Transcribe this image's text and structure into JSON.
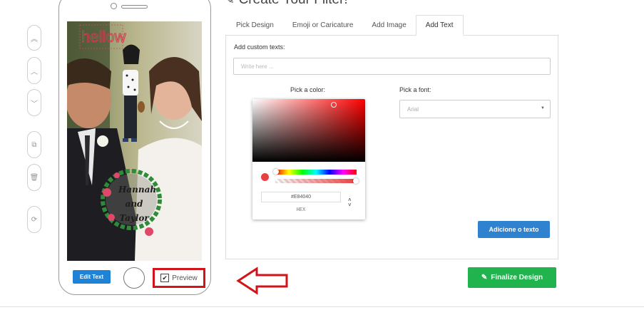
{
  "left_toolbar": {
    "buttons": [
      {
        "name": "bring-to-front",
        "glyph": "«"
      },
      {
        "name": "move-up",
        "glyph": "˄"
      },
      {
        "name": "move-down",
        "glyph": "˅"
      },
      {
        "name": "duplicate",
        "glyph": "⧉"
      },
      {
        "name": "delete",
        "glyph": "🗑"
      },
      {
        "name": "refresh",
        "glyph": "⟳"
      }
    ]
  },
  "phone": {
    "overlay_text": "hellow",
    "wreath_names": "Hannah and Taylor",
    "edit_text_label": "Edit Text",
    "preview_label": "Preview",
    "preview_checked": "✔"
  },
  "panel": {
    "title": "Create Your Filter!",
    "tabs": [
      {
        "label": "Pick Design"
      },
      {
        "label": "Emoji or Caricature"
      },
      {
        "label": "Add Image"
      },
      {
        "label": "Add Text",
        "active": true
      }
    ],
    "custom_text_label": "Add custom texts:",
    "custom_text_placeholder": "Write here ...",
    "pick_color_label": "Pick a color:",
    "pick_font_label": "Pick a font:",
    "font_value": "Arial",
    "color_hex": "#E84040",
    "color_format_label": "HEX",
    "add_text_button": "Adicione o texto",
    "finalize_button": "Finalize Design"
  },
  "colors": {
    "accent_blue": "#2f82d0",
    "finalize_green": "#21b34e",
    "highlight_red": "#d1131a",
    "selected_color": "#E84040"
  }
}
